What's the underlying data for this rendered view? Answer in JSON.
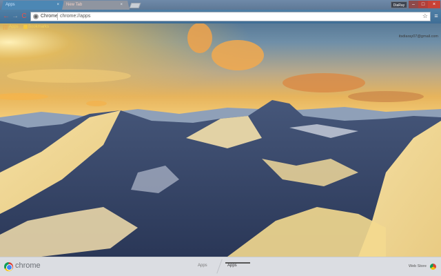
{
  "tabs": [
    {
      "label": "Apps",
      "close": "×"
    },
    {
      "label": "New Tab",
      "close": "×"
    }
  ],
  "window": {
    "profile": "DiaRay",
    "minimize": "–",
    "maximize": "□",
    "close": "×"
  },
  "toolbar": {
    "back_glyph": "←",
    "forward_glyph": "→",
    "reload_glyph": "C",
    "chip_label": "Chrome",
    "url": "chrome://apps",
    "star_glyph": "☆",
    "menu_glyph": "≡"
  },
  "bookmarks": {
    "apps": "Apps",
    "bookmarks": "Bookmarks"
  },
  "account": {
    "email": "itsdiaray07@gmail.com"
  },
  "bottombar": {
    "brand": "chrome",
    "page_tabs": [
      "Apps",
      "Apps"
    ],
    "webstore": "Web Store"
  },
  "colors": {
    "accent": "#e5534b",
    "active_tab": "#4c87b4",
    "bookmark_text": "#f2d35a"
  },
  "icons": [
    "back-arrow-icon",
    "forward-arrow-icon",
    "reload-icon",
    "star-icon",
    "menu-icon",
    "apps-grid-icon",
    "folder-icon",
    "chrome-logo-icon",
    "webstore-icon"
  ]
}
